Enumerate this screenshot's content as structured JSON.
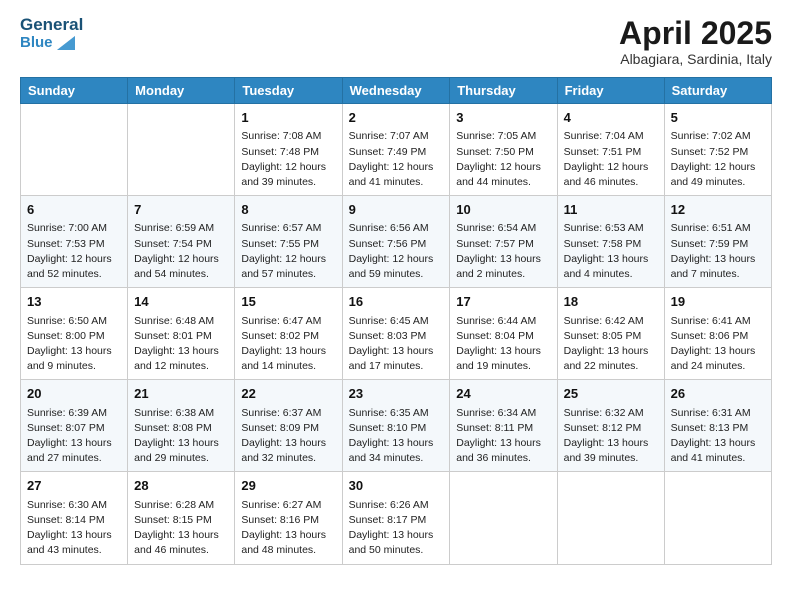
{
  "header": {
    "logo_line1": "General",
    "logo_line2": "Blue",
    "month_title": "April 2025",
    "subtitle": "Albagiara, Sardinia, Italy"
  },
  "weekdays": [
    "Sunday",
    "Monday",
    "Tuesday",
    "Wednesday",
    "Thursday",
    "Friday",
    "Saturday"
  ],
  "weeks": [
    [
      {
        "day": "",
        "info": ""
      },
      {
        "day": "",
        "info": ""
      },
      {
        "day": "1",
        "info": "Sunrise: 7:08 AM\nSunset: 7:48 PM\nDaylight: 12 hours and 39 minutes."
      },
      {
        "day": "2",
        "info": "Sunrise: 7:07 AM\nSunset: 7:49 PM\nDaylight: 12 hours and 41 minutes."
      },
      {
        "day": "3",
        "info": "Sunrise: 7:05 AM\nSunset: 7:50 PM\nDaylight: 12 hours and 44 minutes."
      },
      {
        "day": "4",
        "info": "Sunrise: 7:04 AM\nSunset: 7:51 PM\nDaylight: 12 hours and 46 minutes."
      },
      {
        "day": "5",
        "info": "Sunrise: 7:02 AM\nSunset: 7:52 PM\nDaylight: 12 hours and 49 minutes."
      }
    ],
    [
      {
        "day": "6",
        "info": "Sunrise: 7:00 AM\nSunset: 7:53 PM\nDaylight: 12 hours and 52 minutes."
      },
      {
        "day": "7",
        "info": "Sunrise: 6:59 AM\nSunset: 7:54 PM\nDaylight: 12 hours and 54 minutes."
      },
      {
        "day": "8",
        "info": "Sunrise: 6:57 AM\nSunset: 7:55 PM\nDaylight: 12 hours and 57 minutes."
      },
      {
        "day": "9",
        "info": "Sunrise: 6:56 AM\nSunset: 7:56 PM\nDaylight: 12 hours and 59 minutes."
      },
      {
        "day": "10",
        "info": "Sunrise: 6:54 AM\nSunset: 7:57 PM\nDaylight: 13 hours and 2 minutes."
      },
      {
        "day": "11",
        "info": "Sunrise: 6:53 AM\nSunset: 7:58 PM\nDaylight: 13 hours and 4 minutes."
      },
      {
        "day": "12",
        "info": "Sunrise: 6:51 AM\nSunset: 7:59 PM\nDaylight: 13 hours and 7 minutes."
      }
    ],
    [
      {
        "day": "13",
        "info": "Sunrise: 6:50 AM\nSunset: 8:00 PM\nDaylight: 13 hours and 9 minutes."
      },
      {
        "day": "14",
        "info": "Sunrise: 6:48 AM\nSunset: 8:01 PM\nDaylight: 13 hours and 12 minutes."
      },
      {
        "day": "15",
        "info": "Sunrise: 6:47 AM\nSunset: 8:02 PM\nDaylight: 13 hours and 14 minutes."
      },
      {
        "day": "16",
        "info": "Sunrise: 6:45 AM\nSunset: 8:03 PM\nDaylight: 13 hours and 17 minutes."
      },
      {
        "day": "17",
        "info": "Sunrise: 6:44 AM\nSunset: 8:04 PM\nDaylight: 13 hours and 19 minutes."
      },
      {
        "day": "18",
        "info": "Sunrise: 6:42 AM\nSunset: 8:05 PM\nDaylight: 13 hours and 22 minutes."
      },
      {
        "day": "19",
        "info": "Sunrise: 6:41 AM\nSunset: 8:06 PM\nDaylight: 13 hours and 24 minutes."
      }
    ],
    [
      {
        "day": "20",
        "info": "Sunrise: 6:39 AM\nSunset: 8:07 PM\nDaylight: 13 hours and 27 minutes."
      },
      {
        "day": "21",
        "info": "Sunrise: 6:38 AM\nSunset: 8:08 PM\nDaylight: 13 hours and 29 minutes."
      },
      {
        "day": "22",
        "info": "Sunrise: 6:37 AM\nSunset: 8:09 PM\nDaylight: 13 hours and 32 minutes."
      },
      {
        "day": "23",
        "info": "Sunrise: 6:35 AM\nSunset: 8:10 PM\nDaylight: 13 hours and 34 minutes."
      },
      {
        "day": "24",
        "info": "Sunrise: 6:34 AM\nSunset: 8:11 PM\nDaylight: 13 hours and 36 minutes."
      },
      {
        "day": "25",
        "info": "Sunrise: 6:32 AM\nSunset: 8:12 PM\nDaylight: 13 hours and 39 minutes."
      },
      {
        "day": "26",
        "info": "Sunrise: 6:31 AM\nSunset: 8:13 PM\nDaylight: 13 hours and 41 minutes."
      }
    ],
    [
      {
        "day": "27",
        "info": "Sunrise: 6:30 AM\nSunset: 8:14 PM\nDaylight: 13 hours and 43 minutes."
      },
      {
        "day": "28",
        "info": "Sunrise: 6:28 AM\nSunset: 8:15 PM\nDaylight: 13 hours and 46 minutes."
      },
      {
        "day": "29",
        "info": "Sunrise: 6:27 AM\nSunset: 8:16 PM\nDaylight: 13 hours and 48 minutes."
      },
      {
        "day": "30",
        "info": "Sunrise: 6:26 AM\nSunset: 8:17 PM\nDaylight: 13 hours and 50 minutes."
      },
      {
        "day": "",
        "info": ""
      },
      {
        "day": "",
        "info": ""
      },
      {
        "day": "",
        "info": ""
      }
    ]
  ]
}
